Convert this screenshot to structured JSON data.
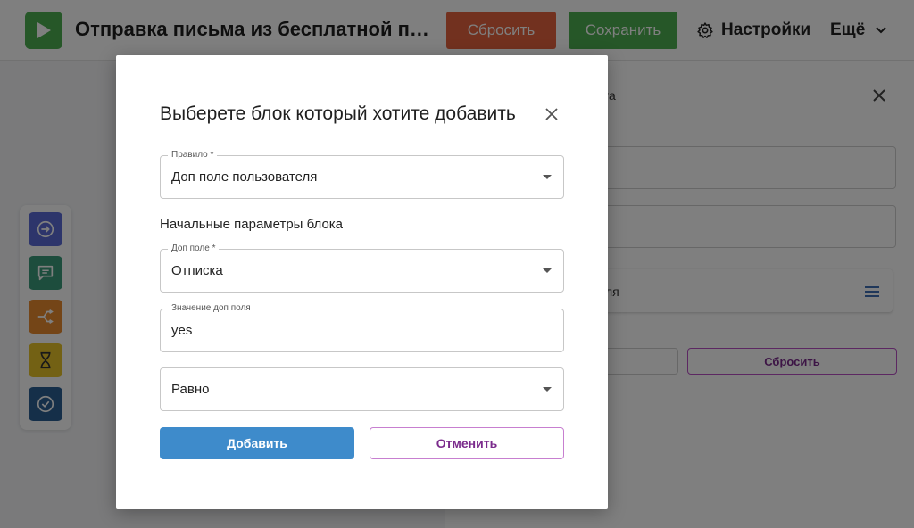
{
  "header": {
    "title": "Отправка письма из бесплатной поз...",
    "reset_label": "Сбросить",
    "save_label": "Сохранить",
    "settings_label": "Настройки",
    "more_label": "Ещё"
  },
  "side_panel": {
    "title_fragment": "нта",
    "rule_label_fragment": "ля",
    "reset_label": "Сбросить"
  },
  "modal": {
    "title": "Выберете блок который хотите добавить",
    "rule_field": {
      "label": "Правило *",
      "value": "Доп поле пользователя"
    },
    "section_label": "Начальные параметры блока",
    "extra_field": {
      "label": "Доп поле *",
      "value": "Отписка"
    },
    "value_field": {
      "label": "Значение доп поля",
      "value": "yes"
    },
    "operator_field": {
      "value": "Равно"
    },
    "add_label": "Добавить",
    "cancel_label": "Отменить"
  },
  "colors": {
    "primary_green": "#4caf50",
    "reset_orange": "#e4633f",
    "add_blue": "#3e8bcb",
    "accent_purple": "#7b2b8c",
    "tool_start": "#5b6bd6",
    "tool_message": "#3b9a7a",
    "tool_split": "#e88a2e",
    "tool_wait": "#e6c229",
    "tool_end": "#2a5f93"
  },
  "palette": {
    "icons": [
      "arrow-circle-icon",
      "message-icon",
      "split-icon",
      "hourglass-icon",
      "check-circle-icon"
    ]
  }
}
